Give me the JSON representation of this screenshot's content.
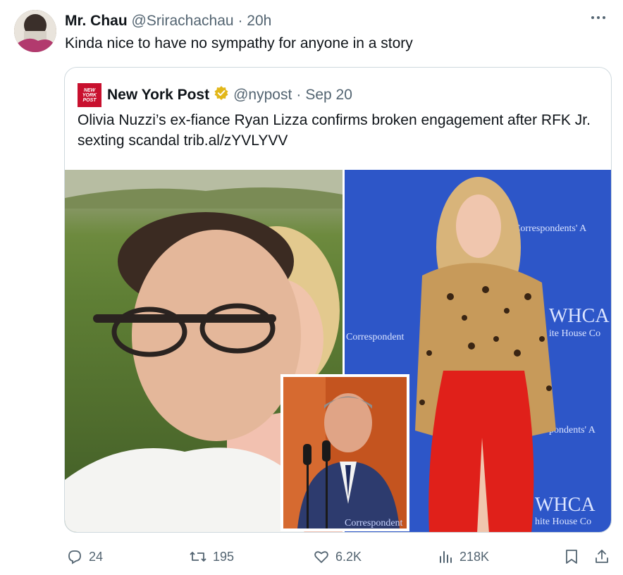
{
  "tweet": {
    "display_name": "Mr. Chau",
    "handle": "@Srirachachau",
    "separator": "·",
    "time": "20h",
    "text": "Kinda nice to have no sympathy for anyone in a story",
    "more_icon": "more-horizontal-icon"
  },
  "quote": {
    "logo_text": [
      "NEW",
      "YORK",
      "POST"
    ],
    "display_name": "New York Post",
    "verified_icon": "verified-gold-badge-icon",
    "handle": "@nypost",
    "separator": "·",
    "date": "Sep 20",
    "text": "Olivia Nuzzi’s ex-fiance Ryan Lizza confirms broken engagement after RFK Jr. sexting scandal trib.al/zYVLYVV",
    "media": {
      "left": "selfie-photo",
      "right": "red-carpet-photo",
      "inset": "podium-photo",
      "backdrop_text": {
        "correspondents_top": "Correspondents' A",
        "correspondent_left": "Correspondent",
        "whca_1": "WHCA",
        "whitehouse_1": "ite House Co",
        "pondents": "pondents' A",
        "whca_2": "WHCA",
        "whitehouse_2": "hite House Co",
        "correspondent_bottom": "Correspondent"
      }
    }
  },
  "actions": {
    "replies": "24",
    "reposts": "195",
    "likes": "6.2K",
    "views": "218K"
  },
  "colors": {
    "text": "#0f1419",
    "secondary": "#536471",
    "border": "#cfd9de",
    "nypost_red": "#c8102e",
    "verified_gold": "#e2b719"
  }
}
